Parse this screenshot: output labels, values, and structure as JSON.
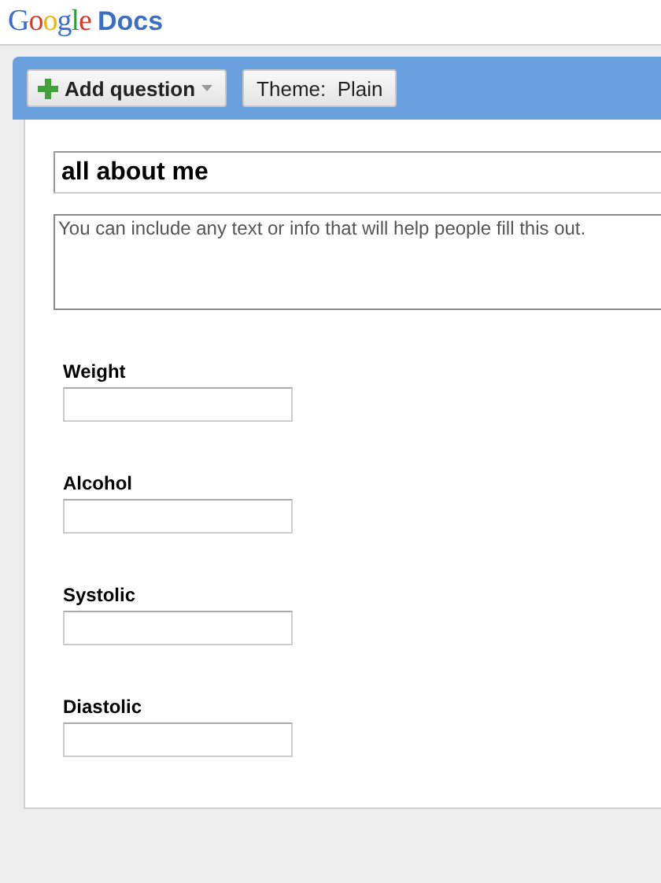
{
  "header": {
    "logo": "Google",
    "product": "Docs"
  },
  "toolbar": {
    "add_button": "Add question",
    "theme_button": "Theme:  Plain"
  },
  "form": {
    "title": "all about me",
    "description_placeholder": "You can include any text or info that will help people fill this out.",
    "questions": [
      {
        "label": "Weight"
      },
      {
        "label": "Alcohol"
      },
      {
        "label": "Systolic"
      },
      {
        "label": "Diastolic"
      }
    ]
  }
}
